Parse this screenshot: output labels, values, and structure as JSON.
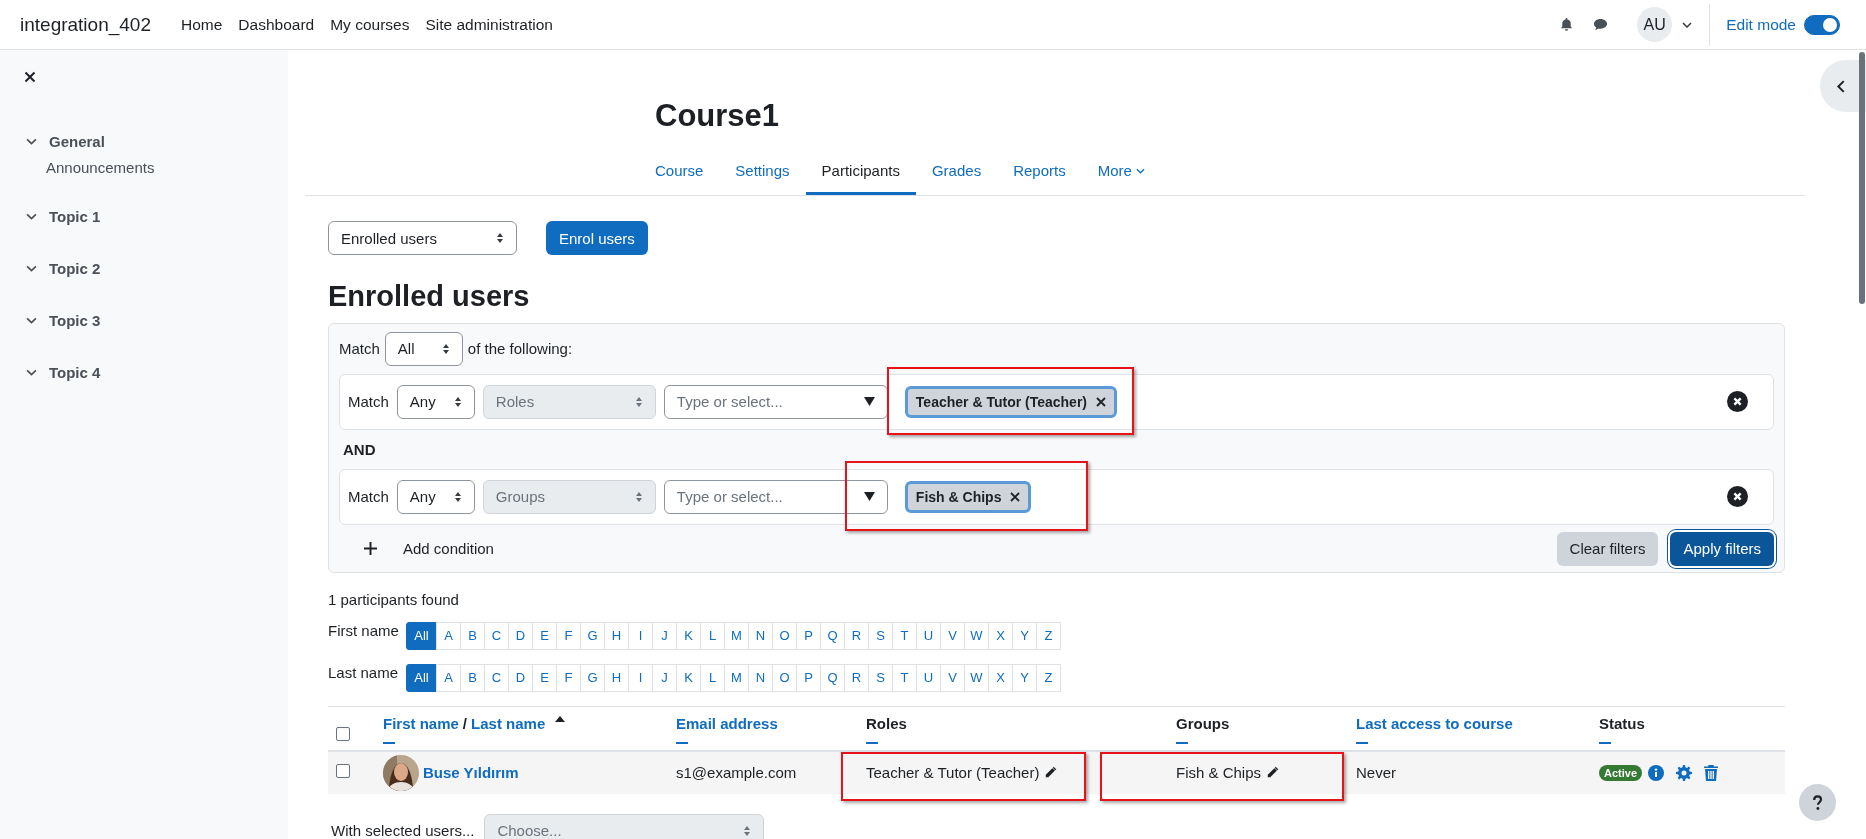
{
  "navbar": {
    "site_name": "integration_402",
    "links": [
      "Home",
      "Dashboard",
      "My courses",
      "Site administration"
    ],
    "avatar_initials": "AU",
    "edit_mode": {
      "label": "Edit mode",
      "on": true
    }
  },
  "course_index": {
    "items": [
      {
        "label": "General",
        "expanded": true,
        "children": [
          {
            "label": "Announcements"
          }
        ]
      },
      {
        "label": "Topic 1",
        "expanded": true
      },
      {
        "label": "Topic 2",
        "expanded": true
      },
      {
        "label": "Topic 3",
        "expanded": true
      },
      {
        "label": "Topic 4",
        "expanded": true
      }
    ]
  },
  "course_title": "Course1",
  "tabs": [
    {
      "label": "Course",
      "selected": false,
      "kind": "link"
    },
    {
      "label": "Settings",
      "selected": false,
      "kind": "link"
    },
    {
      "label": "Participants",
      "selected": true,
      "kind": "link"
    },
    {
      "label": "Grades",
      "selected": false,
      "kind": "link"
    },
    {
      "label": "Reports",
      "selected": false,
      "kind": "link"
    },
    {
      "label": "More",
      "selected": false,
      "kind": "menu"
    }
  ],
  "participants_select": "Enrolled users",
  "enrol_button": "Enrol users",
  "heading": "Enrolled users",
  "filter": {
    "match_label": "Match",
    "match_value": "All",
    "match_suffix": "of the following:",
    "join_label": "AND",
    "rows": [
      {
        "match_label": "Match",
        "match_value": "Any",
        "type": "Roles",
        "placeholder": "Type or select...",
        "chips": [
          "Teacher & Tutor (Teacher)"
        ]
      },
      {
        "match_label": "Match",
        "match_value": "Any",
        "type": "Groups",
        "placeholder": "Type or select...",
        "chips": [
          "Fish & Chips"
        ]
      }
    ],
    "add_condition": "Add condition",
    "clear_button": "Clear filters",
    "apply_button": "Apply filters"
  },
  "participants_found": "1 participants found",
  "initials_bars": [
    {
      "label": "First name",
      "letters": [
        {
          "label": "All",
          "selected": true
        },
        {
          "label": "A",
          "selected": false
        },
        {
          "label": "B",
          "selected": false
        },
        {
          "label": "C",
          "selected": false
        },
        {
          "label": "D",
          "selected": false
        },
        {
          "label": "E",
          "selected": false
        },
        {
          "label": "F",
          "selected": false
        },
        {
          "label": "G",
          "selected": false
        },
        {
          "label": "H",
          "selected": false
        },
        {
          "label": "I",
          "selected": false
        },
        {
          "label": "J",
          "selected": false
        },
        {
          "label": "K",
          "selected": false
        },
        {
          "label": "L",
          "selected": false
        },
        {
          "label": "M",
          "selected": false
        },
        {
          "label": "N",
          "selected": false
        },
        {
          "label": "O",
          "selected": false
        },
        {
          "label": "P",
          "selected": false
        },
        {
          "label": "Q",
          "selected": false
        },
        {
          "label": "R",
          "selected": false
        },
        {
          "label": "S",
          "selected": false
        },
        {
          "label": "T",
          "selected": false
        },
        {
          "label": "U",
          "selected": false
        },
        {
          "label": "V",
          "selected": false
        },
        {
          "label": "W",
          "selected": false
        },
        {
          "label": "X",
          "selected": false
        },
        {
          "label": "Y",
          "selected": false
        },
        {
          "label": "Z",
          "selected": false
        }
      ]
    },
    {
      "label": "Last name",
      "letters": [
        {
          "label": "All",
          "selected": true
        },
        {
          "label": "A",
          "selected": false
        },
        {
          "label": "B",
          "selected": false
        },
        {
          "label": "C",
          "selected": false
        },
        {
          "label": "D",
          "selected": false
        },
        {
          "label": "E",
          "selected": false
        },
        {
          "label": "F",
          "selected": false
        },
        {
          "label": "G",
          "selected": false
        },
        {
          "label": "H",
          "selected": false
        },
        {
          "label": "I",
          "selected": false
        },
        {
          "label": "J",
          "selected": false
        },
        {
          "label": "K",
          "selected": false
        },
        {
          "label": "L",
          "selected": false
        },
        {
          "label": "M",
          "selected": false
        },
        {
          "label": "N",
          "selected": false
        },
        {
          "label": "O",
          "selected": false
        },
        {
          "label": "P",
          "selected": false
        },
        {
          "label": "Q",
          "selected": false
        },
        {
          "label": "R",
          "selected": false
        },
        {
          "label": "S",
          "selected": false
        },
        {
          "label": "T",
          "selected": false
        },
        {
          "label": "U",
          "selected": false
        },
        {
          "label": "V",
          "selected": false
        },
        {
          "label": "W",
          "selected": false
        },
        {
          "label": "X",
          "selected": false
        },
        {
          "label": "Y",
          "selected": false
        },
        {
          "label": "Z",
          "selected": false
        }
      ]
    }
  ],
  "table": {
    "select_all_checked": false,
    "columns": [
      {
        "kind": "name",
        "first": "First name",
        "separator": "/",
        "last": "Last name",
        "sorted": true
      },
      {
        "kind": "sortable",
        "label": "Email address"
      },
      {
        "kind": "plain",
        "label": "Roles"
      },
      {
        "kind": "plain",
        "label": "Groups"
      },
      {
        "kind": "sortable",
        "label": "Last access to course"
      },
      {
        "kind": "plain",
        "label": "Status"
      }
    ],
    "rows": [
      {
        "checked": false,
        "name": "Buse Yıldırım",
        "email": "s1@example.com",
        "roles": "Teacher & Tutor (Teacher)",
        "groups": "Fish & Chips",
        "last_access": "Never",
        "status": "Active"
      }
    ]
  },
  "bulk_action": {
    "label": "With selected users...",
    "placeholder": "Choose..."
  }
}
